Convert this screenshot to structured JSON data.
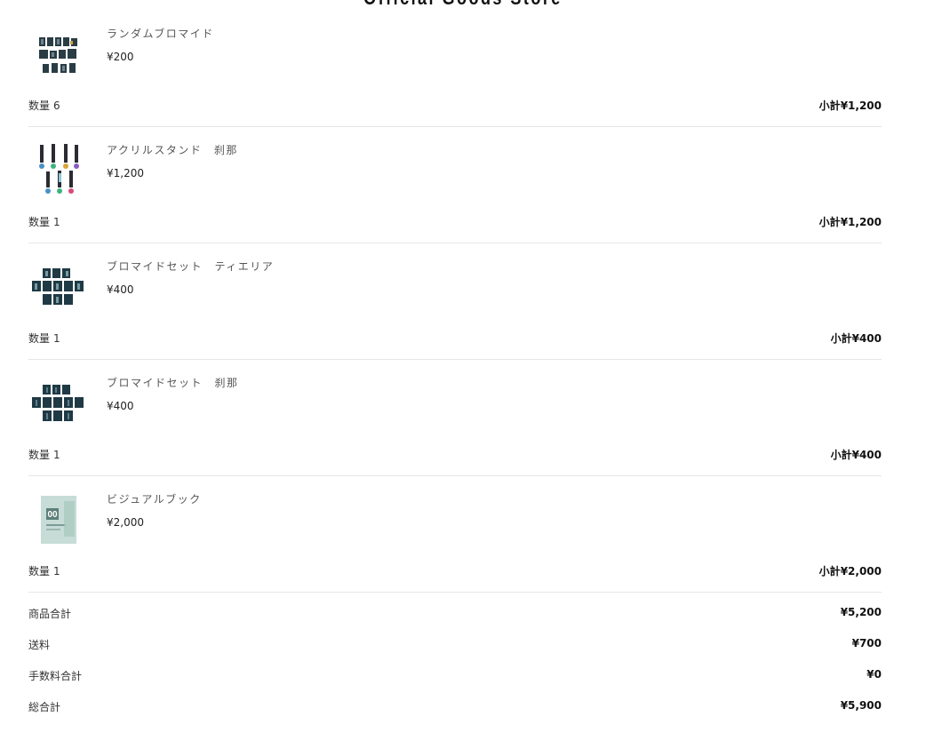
{
  "header": {
    "store_title": "Official Goods Store"
  },
  "items": [
    {
      "name": "ランダムブロマイド",
      "price": "¥200",
      "quantity_label": "数量",
      "quantity": "6",
      "subtotal_label": "小計",
      "subtotal": "¥1,200",
      "thumbnail_icon": "random-bromide-thumbnail"
    },
    {
      "name": "アクリルスタンド　刹那",
      "price": "¥1,200",
      "quantity_label": "数量",
      "quantity": "1",
      "subtotal_label": "小計",
      "subtotal": "¥1,200",
      "thumbnail_icon": "acrylic-stand-thumbnail"
    },
    {
      "name": "ブロマイドセット　ティエリア",
      "price": "¥400",
      "quantity_label": "数量",
      "quantity": "1",
      "subtotal_label": "小計",
      "subtotal": "¥400",
      "thumbnail_icon": "bromide-set-thumbnail"
    },
    {
      "name": "ブロマイドセット　刹那",
      "price": "¥400",
      "quantity_label": "数量",
      "quantity": "1",
      "subtotal_label": "小計",
      "subtotal": "¥400",
      "thumbnail_icon": "bromide-set-thumbnail"
    },
    {
      "name": "ビジュアルブック",
      "price": "¥2,000",
      "quantity_label": "数量",
      "quantity": "1",
      "subtotal_label": "小計",
      "subtotal": "¥2,000",
      "thumbnail_icon": "visual-book-thumbnail",
      "thumbnail_text": "00"
    }
  ],
  "summary": {
    "items_total_label": "商品合計",
    "items_total": "¥5,200",
    "shipping_label": "送料",
    "shipping": "¥700",
    "fee_total_label": "手数料合計",
    "fee_total": "¥0",
    "grand_total_label": "総合計",
    "grand_total": "¥5,900"
  },
  "colors": {
    "divider": "#e6e6e6",
    "text_muted": "#555555",
    "text_bold": "#111111"
  }
}
